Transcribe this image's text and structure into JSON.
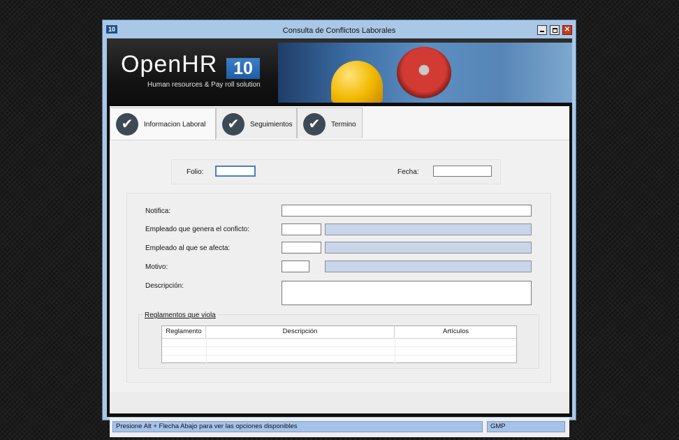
{
  "window": {
    "app_icon": "10",
    "title": "Consulta de Conflictos Laborales",
    "controls": {
      "minimize": "",
      "maximize": "",
      "close": "✕"
    }
  },
  "banner": {
    "logo_text": "OpenHR",
    "logo_number": "10",
    "tagline": "Human resources & Pay roll solution"
  },
  "tabs": [
    {
      "label": "Informacion Laboral",
      "active": true,
      "icon": "check-icon"
    },
    {
      "label": "Seguimientos",
      "active": false,
      "icon": "check-icon"
    },
    {
      "label": "Termino",
      "active": false,
      "icon": "check-icon"
    }
  ],
  "form": {
    "folio": {
      "label": "Folio:",
      "value": ""
    },
    "fecha": {
      "label": "Fecha:",
      "value": ""
    },
    "notifica": {
      "label": "Notifica:",
      "value": ""
    },
    "empleado_genera": {
      "label": "Empleado que genera el conficto:",
      "code": "",
      "name": ""
    },
    "empleado_afecta": {
      "label": "Empleado al que se afecta:",
      "code": "",
      "name": ""
    },
    "motivo": {
      "label": "Motivo:",
      "code": "",
      "name": ""
    },
    "descripcion": {
      "label": "Descripción:",
      "value": ""
    }
  },
  "reglamentos": {
    "title": "Reglamentos que viola",
    "columns": [
      "Reglamento",
      "Descripción",
      "Artículos"
    ],
    "rows": [
      [
        "",
        "",
        ""
      ],
      [
        "",
        "",
        ""
      ],
      [
        "",
        "",
        ""
      ]
    ]
  },
  "status": {
    "message": "Presione Alt + Flecha Abajo para ver las opciones disponibles",
    "company": "GMP"
  },
  "colors": {
    "titlebar": "#a9c8e8",
    "status_fill": "#a5c3ea",
    "readonly_field": "#c9d6ea",
    "tab_check": "#3d4a56",
    "logo_box": "#1e5ea8"
  }
}
